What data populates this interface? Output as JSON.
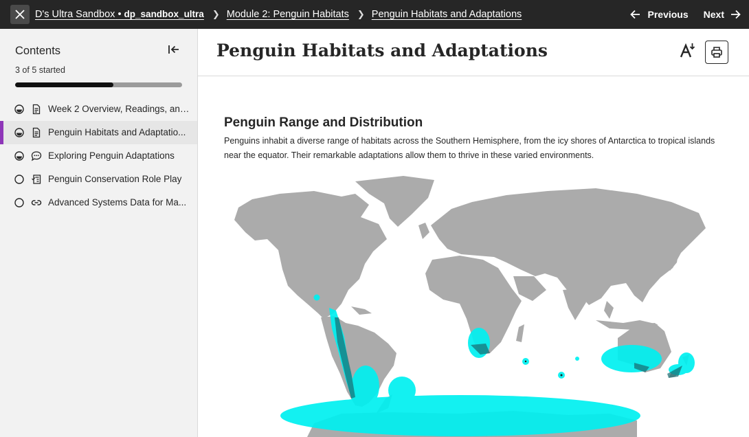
{
  "topbar": {
    "course_name": "D's Ultra Sandbox",
    "course_separator": "•",
    "course_code": "dp_sandbox_ultra",
    "module": "Module 2: Penguin Habitats",
    "current_page": "Penguin Habitats and Adaptations",
    "previous_label": "Previous",
    "next_label": "Next"
  },
  "sidebar": {
    "title": "Contents",
    "progress_text": "3 of 5 started",
    "progress_fraction": 0.59,
    "items": [
      {
        "label": "Week 2 Overview, Readings, and...",
        "status": "started",
        "type": "document-icon"
      },
      {
        "label": "Penguin Habitats and Adaptatio...",
        "status": "started",
        "type": "document-icon",
        "active": true
      },
      {
        "label": "Exploring Penguin Adaptations",
        "status": "started",
        "type": "discussion-icon"
      },
      {
        "label": "Penguin Conservation Role Play",
        "status": "not-started",
        "type": "assignment-icon"
      },
      {
        "label": "Advanced Systems Data for Ma...",
        "status": "not-started",
        "type": "link-icon"
      }
    ]
  },
  "main": {
    "title": "Penguin Habitats and Adaptations",
    "section": {
      "heading": "Penguin Range and Distribution",
      "text": "Penguins inhabit a diverse range of habitats across the Southern Hemisphere, from the icy shores of Antarctica to tropical islands near the equator. Their remarkable adaptations allow them to thrive in these varied environments."
    }
  },
  "colors": {
    "topbar": "#262626",
    "accent": "#8e36b8",
    "land": "#ababab",
    "penguin_range": "#00f0f0"
  }
}
